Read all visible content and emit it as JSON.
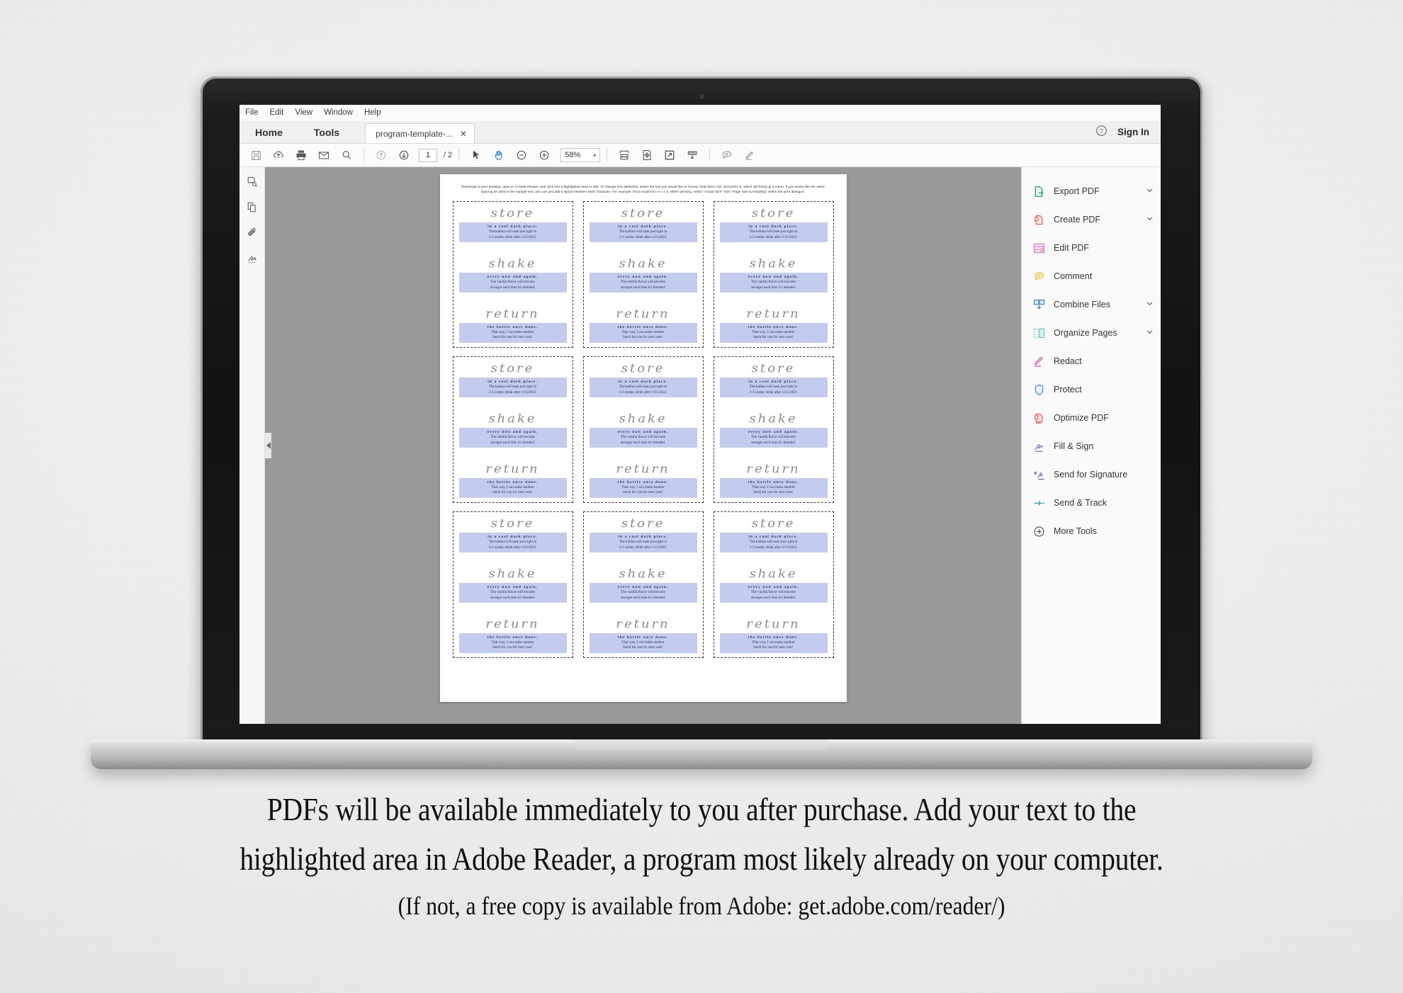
{
  "window": {
    "menubar": [
      "File",
      "Edit",
      "View",
      "Window",
      "Help"
    ],
    "tabs": {
      "home": "Home",
      "tools": "Tools"
    },
    "document_tab": {
      "title": "program-template-...",
      "close": "✕"
    },
    "help_icon": "help-circle-icon",
    "signin": "Sign In"
  },
  "toolbar": {
    "icons": [
      "save-icon",
      "upload-cloud-icon",
      "print-icon",
      "email-icon",
      "search-icon"
    ],
    "nav": [
      "page-up-icon",
      "page-down-icon"
    ],
    "page_value": "1",
    "page_total": "/ 2",
    "tools": [
      "select-cursor-icon",
      "hand-tool-icon",
      "zoom-out-icon",
      "zoom-in-icon"
    ],
    "zoom_value": "58%",
    "zoom_caret": "▾",
    "view_icons": [
      "fit-width-icon",
      "fit-page-icon",
      "zoom-selection-icon",
      "scroll-mode-icon"
    ],
    "annot_icons": [
      "comment-icon",
      "highlight-icon"
    ]
  },
  "left_rail": {
    "items": [
      "page-thumbnails-icon",
      "pages-panel-icon",
      "attachments-icon",
      "signatures-icon"
    ]
  },
  "right_panel": {
    "tools": [
      {
        "label": "Export PDF",
        "icon": "export-pdf-icon",
        "chevron": true,
        "color": "#2aa17c"
      },
      {
        "label": "Create PDF",
        "icon": "create-pdf-icon",
        "chevron": true,
        "color": "#e8695c"
      },
      {
        "label": "Edit PDF",
        "icon": "edit-pdf-icon",
        "chevron": false,
        "color": "#e07ac0"
      },
      {
        "label": "Comment",
        "icon": "comment-icon",
        "chevron": false,
        "color": "#f2c14e"
      },
      {
        "label": "Combine Files",
        "icon": "combine-files-icon",
        "chevron": true,
        "color": "#3a7bd5"
      },
      {
        "label": "Organize Pages",
        "icon": "organize-pages-icon",
        "chevron": true,
        "color": "#57c7d4"
      },
      {
        "label": "Redact",
        "icon": "redact-icon",
        "chevron": false,
        "color": "#e35fb0"
      },
      {
        "label": "Protect",
        "icon": "protect-shield-icon",
        "chevron": false,
        "color": "#4a90e2"
      },
      {
        "label": "Optimize PDF",
        "icon": "optimize-pdf-icon",
        "chevron": false,
        "color": "#e8695c"
      },
      {
        "label": "Fill & Sign",
        "icon": "fill-and-sign-icon",
        "chevron": false,
        "color": "#7d73d8"
      },
      {
        "label": "Send for Signature",
        "icon": "send-for-signature-icon",
        "chevron": false,
        "color": "#6a63c4"
      },
      {
        "label": "Send & Track",
        "icon": "send-and-track-icon",
        "chevron": false,
        "color": "#3aa6d0"
      },
      {
        "label": "More Tools",
        "icon": "more-tools-plus-icon",
        "chevron": false,
        "color": "#555555"
      }
    ]
  },
  "document": {
    "instructions": "Download to your desktop, open in Acrobat Reader, and click into a highlighted area to edit. To change font attributes, select the text you would like to format, hold down Ctrl, and press E, which will bring up a menu.  If you would like the same spacing as used in the sample text, you can just add a space between each character. For example, Erica would be: e r i c a.  When printing, select \"Actual Size\" from \"Page Size & Handling\" within the print dialogue.",
    "card": {
      "blocks": [
        {
          "script": "store",
          "lead": "in a cool dark place.",
          "sub_line1": "The kahlua will taste just right in",
          "sub_line2": "2-3 weeks; drink after 1/15/2022."
        },
        {
          "script": "shake",
          "lead": "every now and again.",
          "sub_line1": "The vanilla flavor will become",
          "sub_line2": "stronger each time it's blended."
        },
        {
          "script": "return",
          "lead": "the bottle once done.",
          "sub_line1": "That way, I can make another",
          "sub_line2": "batch for you for next year!"
        }
      ]
    },
    "card_count": 9,
    "highlight_color": "#c3ccef"
  },
  "caption": {
    "line1": "PDFs will be available immediately to you after purchase.  Add your text to the",
    "line2": "highlighted area in Adobe Reader, a program most likely already on your computer.",
    "line3": "(If not, a free copy is available from Adobe: get.adobe.com/reader/)"
  }
}
